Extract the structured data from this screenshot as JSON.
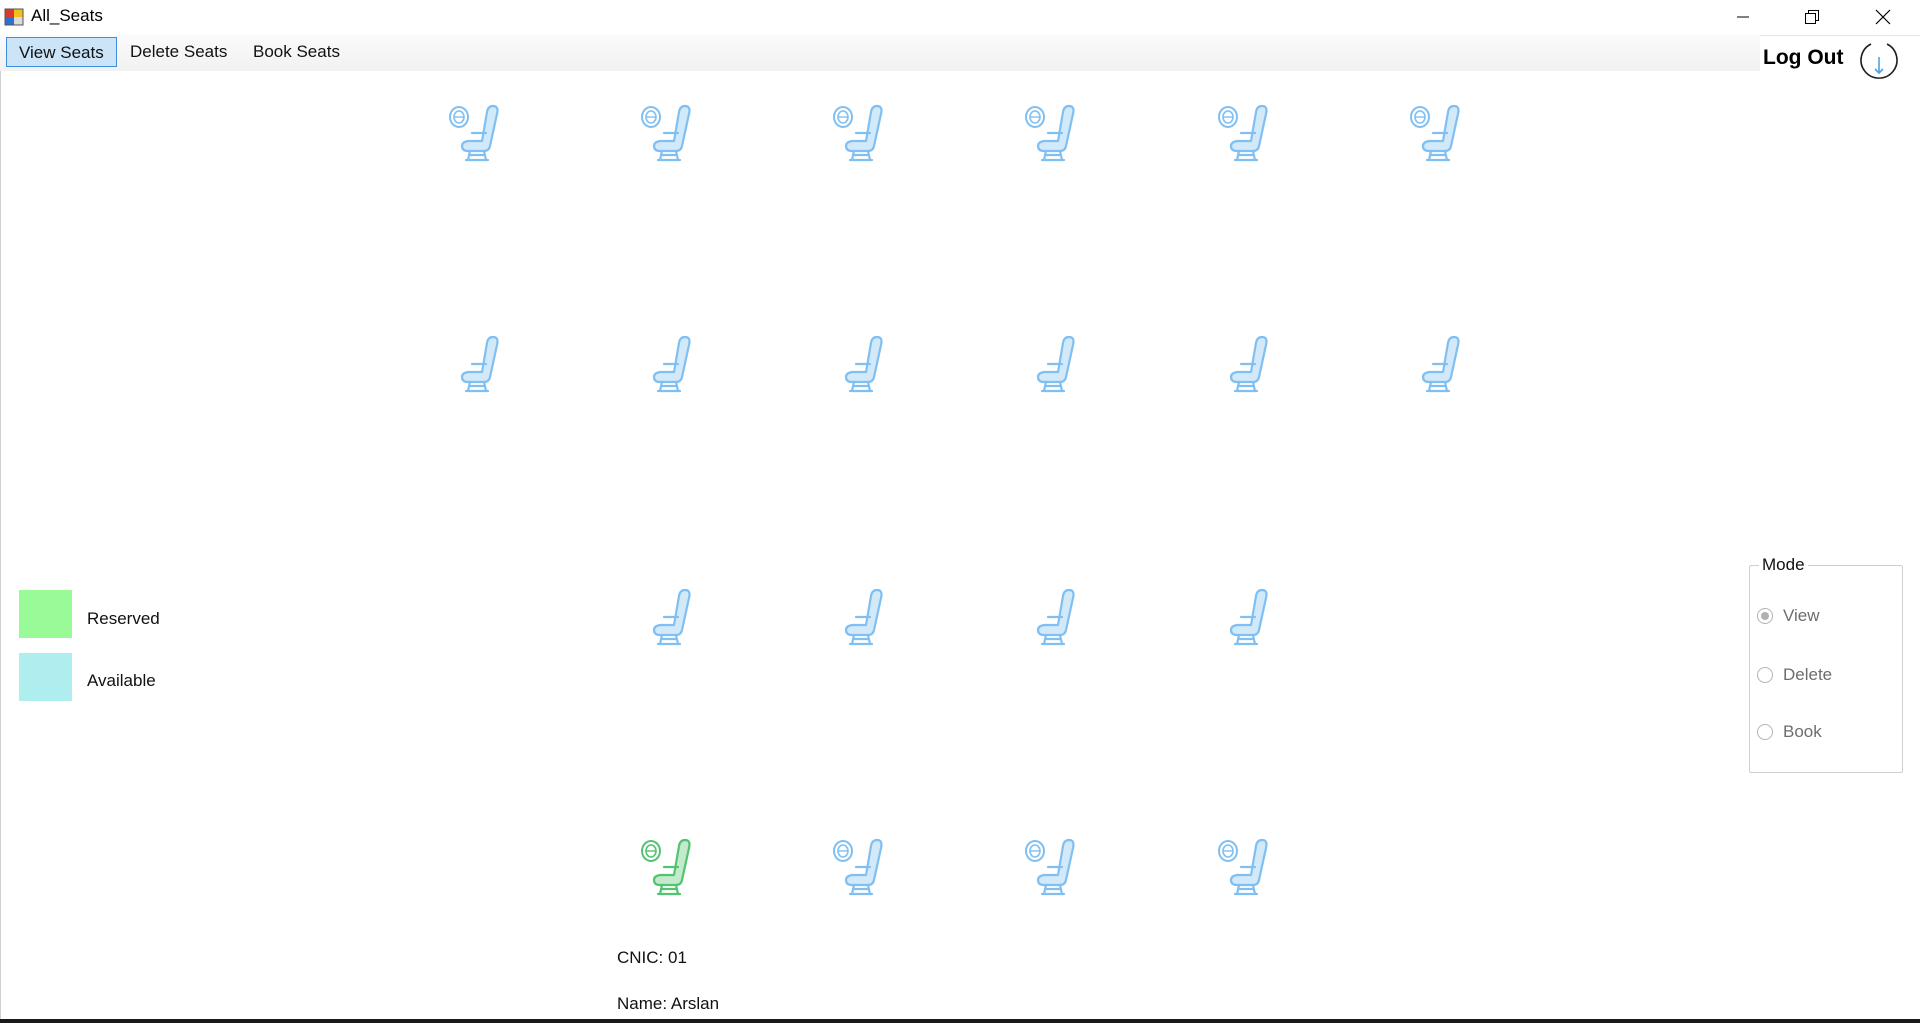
{
  "window": {
    "title": "All_Seats",
    "icons": {
      "app": "windows-form-icon",
      "minimize": "minimize-icon",
      "restore": "restore-icon",
      "close": "close-icon"
    }
  },
  "menu": {
    "items": [
      {
        "label": "View Seats",
        "active": true
      },
      {
        "label": "Delete Seats",
        "active": false
      },
      {
        "label": "Book Seats",
        "active": false
      }
    ]
  },
  "header": {
    "logout_label": "Log Out",
    "logout_icon": "power-down-icon"
  },
  "colors": {
    "available_seat": "#7fbff2",
    "reserved_seat": "#52c470",
    "reserved_legend": "#98fb98",
    "available_legend": "#afeeee",
    "active_menu_bg": "#cce4f7",
    "active_menu_border": "#3d8ee0"
  },
  "seats": {
    "rows": [
      {
        "window": true,
        "seats": [
          "available",
          "available",
          "available",
          "available",
          "available",
          "available"
        ]
      },
      {
        "window": false,
        "seats": [
          "available",
          "available",
          "available",
          "available",
          "available",
          "available"
        ]
      },
      {
        "window": false,
        "seats": [
          "available",
          "available",
          "available",
          "available"
        ]
      },
      {
        "window": true,
        "seats": [
          "reserved",
          "available",
          "available",
          "available"
        ]
      }
    ]
  },
  "legend": {
    "reserved_label": "Reserved",
    "available_label": "Available"
  },
  "mode": {
    "title": "Mode",
    "options": [
      {
        "label": "View",
        "selected": true
      },
      {
        "label": "Delete",
        "selected": false
      },
      {
        "label": "Book",
        "selected": false
      }
    ]
  },
  "passenger": {
    "cnic": "CNIC: 01",
    "name": "Name: Arslan"
  }
}
